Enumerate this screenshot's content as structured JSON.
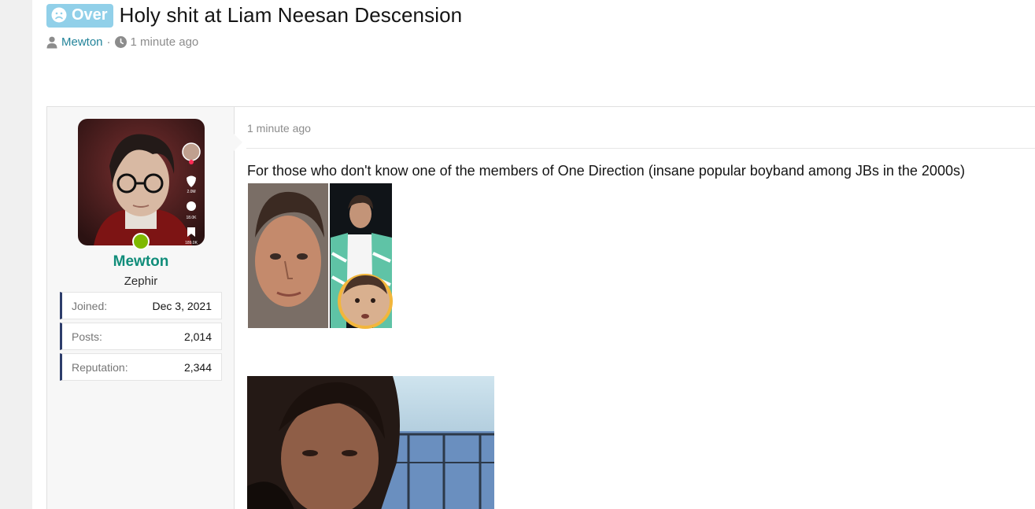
{
  "thread": {
    "prefix_label": "Over",
    "title": "Holy shit at Liam Neesan Descension",
    "author": "Mewton",
    "separator": "·",
    "time_ago": "1 minute ago"
  },
  "post": {
    "user": {
      "name": "Mewton",
      "title": "Zephir",
      "online": true,
      "stats": [
        {
          "key": "Joined:",
          "value": "Dec 3, 2021"
        },
        {
          "key": "Posts:",
          "value": "2,014"
        },
        {
          "key": "Reputation:",
          "value": "2,344"
        }
      ]
    },
    "time_ago": "1 minute ago",
    "body_text": "For those who don't know one of the members of One Direction (insane popular boyband among JBs in the 2000s)"
  },
  "icons": [
    "sad-face-icon",
    "user-icon",
    "clock-icon"
  ],
  "colors": {
    "prefix_bg": "#91d0e9",
    "link": "#23849a",
    "username": "#118d7a",
    "online": "#7fb900",
    "stat_accent": "#2d3d6b"
  }
}
